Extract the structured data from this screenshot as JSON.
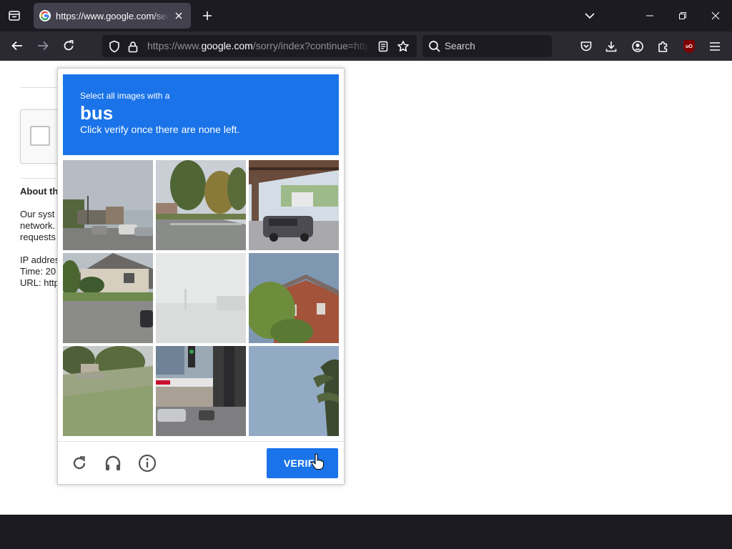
{
  "browser": {
    "tab": {
      "title": "https://www.google.com/search",
      "close_icon": "close-icon",
      "favicon": "google-g-icon"
    },
    "url": {
      "prefix": "https://www.",
      "host": "google.com",
      "path": "/sorry/index?continue=https"
    },
    "search_placeholder": "Search",
    "ublock_label": "uO"
  },
  "page": {
    "about_heading": "About th",
    "paragraph_lines": [
      "Our syst",
      "network.",
      "requests"
    ],
    "info_lines": [
      "IP addres",
      "Time: 20",
      "URL: http"
    ]
  },
  "captcha": {
    "prompt_small": "Select all images with a",
    "target": "bus",
    "instruction": "Click verify once there are none left.",
    "verify_label": "VERIFY",
    "accent_color": "#1a73e8",
    "tiles": [
      "street-with-parked-cars",
      "tree-lined-street",
      "car-under-railway-bridge",
      "house-with-lawn",
      "faded-blank",
      "brick-house-with-tree",
      "grassy-roadside",
      "gas-station-traffic-light",
      "sky-with-palm-tree"
    ],
    "icons": [
      "reload-icon",
      "headphones-icon",
      "info-icon"
    ]
  },
  "colors": {
    "titlebar": "#1c1b22",
    "navbar": "#2b2a33",
    "tab_active": "#42414d"
  }
}
